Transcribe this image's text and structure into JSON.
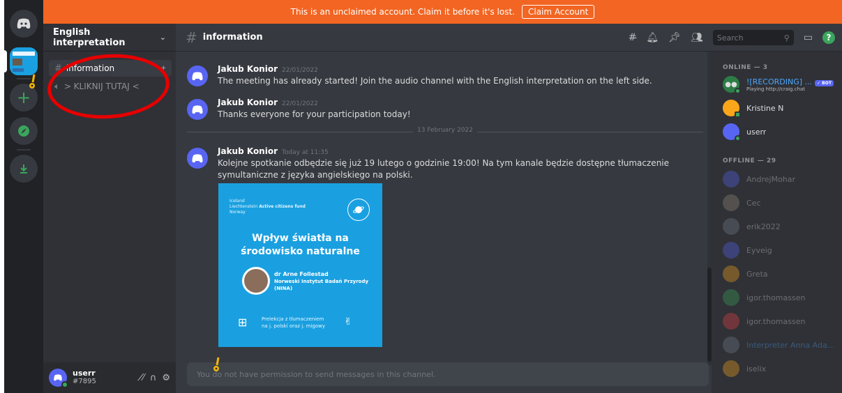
{
  "banner": {
    "text": "This is an unclaimed account. Claim it before it's lost.",
    "button": "Claim Account"
  },
  "guild": {
    "name": "English interpretation"
  },
  "channels": [
    {
      "name": "information",
      "type": "text",
      "active": true
    },
    {
      "name": "> KLIKNIJ TUTAJ <",
      "type": "voice",
      "active": false
    }
  ],
  "user": {
    "name": "userr",
    "tag": "#7895"
  },
  "header": {
    "channel": "information",
    "search_placeholder": "Search"
  },
  "messages": [
    {
      "author": "Jakub Konior",
      "time": "22/01/2022",
      "text": "The meeting has already started! Join the audio channel with the English interpretation on the left side."
    },
    {
      "author": "Jakub Konior",
      "time": "22/01/2022",
      "text": "Thanks everyone for your participation today!"
    },
    {
      "author": "Jakub Konior",
      "time": "Today at 11:35",
      "text": "Kolejne spotkanie odbędzie się już 19 lutego o godzinie 19:00! Na tym kanale będzie dostępne tłumaczenie symultaniczne z języka angielskiego na polski."
    }
  ],
  "date_divider": "13 February 2022",
  "poster": {
    "logo_lines": [
      "Iceland",
      "Liechtenstein",
      "Norway"
    ],
    "logo_fund": "Active citizens fund",
    "title_line1": "Wpływ światła na",
    "title_line2": "środowisko naturalne",
    "speaker": "dr Arne Follestad",
    "institute": "Norweski Instytut Badań Przyrody",
    "institute_abbr": "(NINA)",
    "foot_line1": "Prelekcja z tłumaczeniem",
    "foot_line2": "na j. polski oraz j. migowy"
  },
  "composer": {
    "placeholder": "You do not have permission to send messages in this channel."
  },
  "members": {
    "online_header": "ONLINE — 3",
    "offline_header": "OFFLINE — 29",
    "online": [
      {
        "name": "![RECORDING] ...",
        "sub": "Playing http://craig.chat",
        "bot": "✓ BOT",
        "color": "#2d7d46"
      },
      {
        "name": "Kristine N",
        "color": "#faa61a"
      },
      {
        "name": "userr",
        "color": "#5865f2"
      }
    ],
    "offline": [
      {
        "name": "AndrejMohar",
        "color": "#5865f2"
      },
      {
        "name": "Cec",
        "color": "#9b8b7d"
      },
      {
        "name": "erik2022",
        "color": "#747f8d"
      },
      {
        "name": "Eyveig",
        "color": "#5865f2"
      },
      {
        "name": "Greta",
        "color": "#faa61a"
      },
      {
        "name": "igor.thomassen",
        "color": "#3ba55d"
      },
      {
        "name": "igor.thomassen",
        "color": "#ed4245"
      },
      {
        "name": "Interpreter Anna Ada...",
        "color": "#747f8d"
      },
      {
        "name": "iselix",
        "color": "#faa61a"
      }
    ]
  },
  "colors": {
    "accent": "#5865f2",
    "banner": "#f26522",
    "annotation_red": "#e60000",
    "online": "#3ba55d"
  }
}
